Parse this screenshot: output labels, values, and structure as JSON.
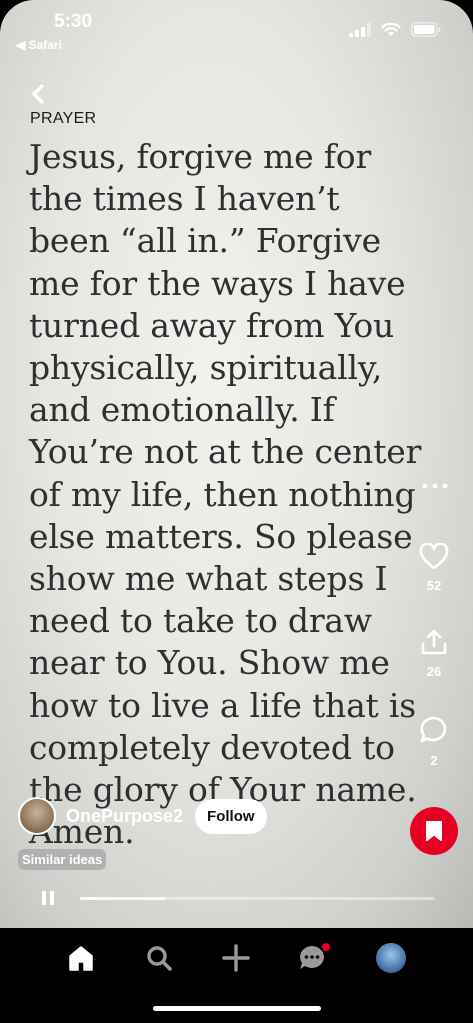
{
  "status_bar": {
    "time": "5:30",
    "back_app": "◀ Safari"
  },
  "pin": {
    "label": "PRAYER",
    "prayer_text": "Jesus, forgive me for\nthe times I haven’t\nbeen “all in.” Forgive\nme for the ways I have\nturned away from You\nphysically, spiritually,\nand emotionally. If\nYou’re not at the center\nof my life, then nothing\nelse matters. So please\nshow me what steps I\nneed to take to draw\nnear to You. Show me\nhow to live a life that is\ncompletely devoted to\nthe glory of Your name.\nAmen."
  },
  "actions": {
    "like_count": "52",
    "share_count": "26",
    "comment_count": "2"
  },
  "creator": {
    "name": "OnePurpose2",
    "follow_label": "Follow"
  },
  "similar_label": "Similar ideas",
  "video": {
    "progress": 0.24
  },
  "colors": {
    "save_red": "#e60023",
    "notification_dot": "#e60023"
  },
  "tab_bar": {
    "items": [
      "home-icon",
      "search-icon",
      "plus-icon",
      "messages-icon",
      "profile-avatar"
    ]
  }
}
